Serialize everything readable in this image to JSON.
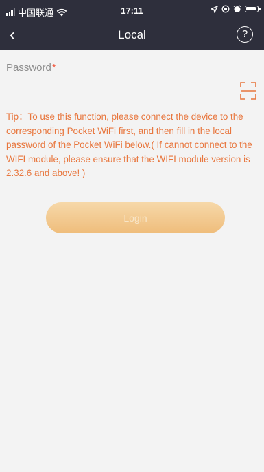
{
  "status_bar": {
    "carrier": "中国联通",
    "wifi_icon": "wifi-icon",
    "time": "17:11",
    "right_icons": [
      "location-arrow-icon",
      "lock-rotation-icon",
      "alarm-icon",
      "battery-icon"
    ]
  },
  "nav": {
    "back_icon": "chevron-left-icon",
    "back_glyph": "‹",
    "title": "Local",
    "help_glyph": "?"
  },
  "form": {
    "password_label": "Password",
    "required_mark": "*",
    "password_value": "",
    "scan_icon": "scan-icon"
  },
  "tip": "Tip：To use this function, please connect the device to the corresponding Pocket WiFi first, and then fill in the local password of the Pocket WiFi below.( If cannot connect to the WIFI module, please ensure that the WIFI module version is 2.32.6 and above! )",
  "login_label": "Login",
  "colors": {
    "header_bg": "#2e2f3c",
    "page_bg": "#f3f3f3",
    "accent": "#e8763d",
    "required": "#f25d44",
    "button_gradient_top": "#f6d8a9",
    "button_gradient_bottom": "#efbd7b"
  }
}
